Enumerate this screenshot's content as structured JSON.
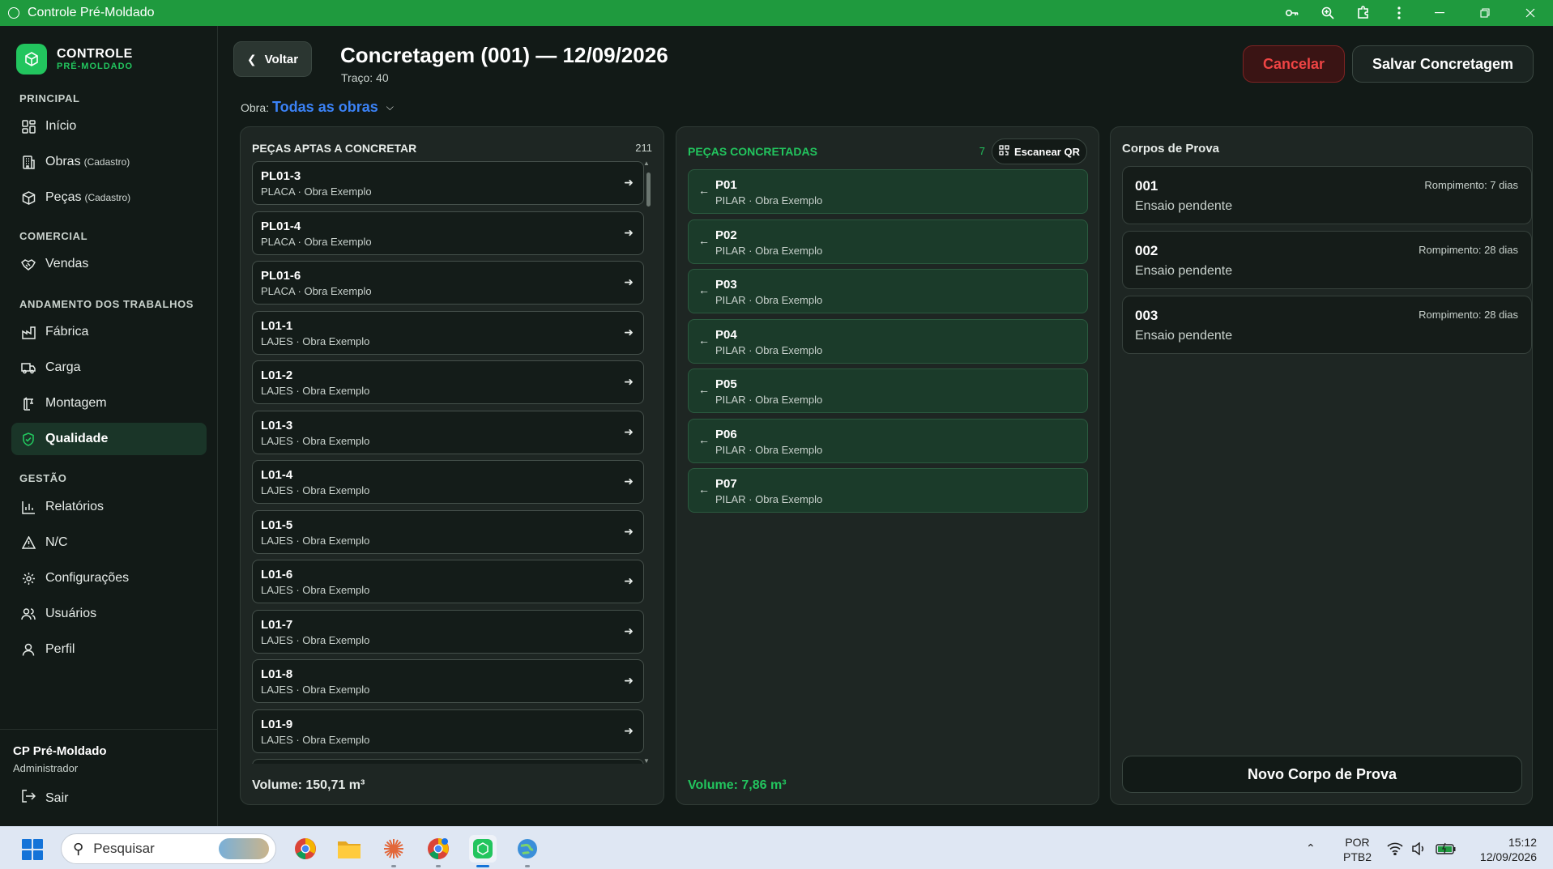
{
  "window": {
    "title": "Controle Pré-Moldado"
  },
  "brand": {
    "title": "CONTROLE",
    "subtitle": "PRÉ-MOLDADO"
  },
  "sidebar": {
    "sections": {
      "principal": "PRINCIPAL",
      "comercial": "COMERCIAL",
      "andamento": "ANDAMENTO DOS TRABALHOS",
      "gestao": "GESTÃO"
    },
    "items": {
      "inicio": "Início",
      "obras": "Obras",
      "obras_note": "(Cadastro)",
      "pecas": "Peças",
      "pecas_note": "(Cadastro)",
      "vendas": "Vendas",
      "fabrica": "Fábrica",
      "carga": "Carga",
      "montagem": "Montagem",
      "qualidade": "Qualidade",
      "relatorios": "Relatórios",
      "nc": "N/C",
      "configuracoes": "Configurações",
      "usuarios": "Usuários",
      "perfil": "Perfil"
    },
    "user": {
      "name": "CP Pré-Moldado",
      "role": "Administrador"
    },
    "logout": "Sair"
  },
  "header": {
    "back": "Voltar",
    "title": "Concretagem (001) — 12/09/2026",
    "trace": "Traço: 40",
    "obra_label": "Obra:",
    "obra_value": "Todas as obras",
    "cancel": "Cancelar",
    "save": "Salvar Concretagem"
  },
  "aptas": {
    "title": "PEÇAS APTAS A CONCRETAR",
    "count": "211",
    "items": [
      {
        "code": "PL01-3",
        "meta": "PLACA · Obra Exemplo"
      },
      {
        "code": "PL01-4",
        "meta": "PLACA · Obra Exemplo"
      },
      {
        "code": "PL01-6",
        "meta": "PLACA · Obra Exemplo"
      },
      {
        "code": "L01-1",
        "meta": "LAJES · Obra Exemplo"
      },
      {
        "code": "L01-2",
        "meta": "LAJES · Obra Exemplo"
      },
      {
        "code": "L01-3",
        "meta": "LAJES · Obra Exemplo"
      },
      {
        "code": "L01-4",
        "meta": "LAJES · Obra Exemplo"
      },
      {
        "code": "L01-5",
        "meta": "LAJES · Obra Exemplo"
      },
      {
        "code": "L01-6",
        "meta": "LAJES · Obra Exemplo"
      },
      {
        "code": "L01-7",
        "meta": "LAJES · Obra Exemplo"
      },
      {
        "code": "L01-8",
        "meta": "LAJES · Obra Exemplo"
      },
      {
        "code": "L01-9",
        "meta": "LAJES · Obra Exemplo"
      },
      {
        "code": "",
        "meta": ""
      }
    ],
    "volume": "Volume: 150,71 m³"
  },
  "concretadas": {
    "title": "PEÇAS CONCRETADAS",
    "count": "7",
    "scan": "Escanear QR",
    "items": [
      {
        "code": "P01",
        "meta": "PILAR · Obra Exemplo"
      },
      {
        "code": "P02",
        "meta": "PILAR · Obra Exemplo"
      },
      {
        "code": "P03",
        "meta": "PILAR · Obra Exemplo"
      },
      {
        "code": "P04",
        "meta": "PILAR · Obra Exemplo"
      },
      {
        "code": "P05",
        "meta": "PILAR · Obra Exemplo"
      },
      {
        "code": "P06",
        "meta": "PILAR · Obra Exemplo"
      },
      {
        "code": "P07",
        "meta": "PILAR · Obra Exemplo"
      }
    ],
    "volume": "Volume: 7,86 m³"
  },
  "corpos": {
    "title": "Corpos de Prova",
    "items": [
      {
        "num": "001",
        "status": "Ensaio pendente",
        "rompimento": "Rompimento: 7 dias"
      },
      {
        "num": "002",
        "status": "Ensaio pendente",
        "rompimento": "Rompimento: 28 dias"
      },
      {
        "num": "003",
        "status": "Ensaio pendente",
        "rompimento": "Rompimento: 28 dias"
      }
    ],
    "new": "Novo Corpo de Prova"
  },
  "taskbar": {
    "search_placeholder": "Pesquisar",
    "lang1": "POR",
    "lang2": "PTB2",
    "time": "15:12",
    "date": "12/09/2026"
  },
  "colors": {
    "accent": "#22c55e",
    "titlebar": "#1f9a3e",
    "link": "#3b82f6",
    "danger": "#ef4444",
    "done_bg": "#1b3b2a"
  }
}
